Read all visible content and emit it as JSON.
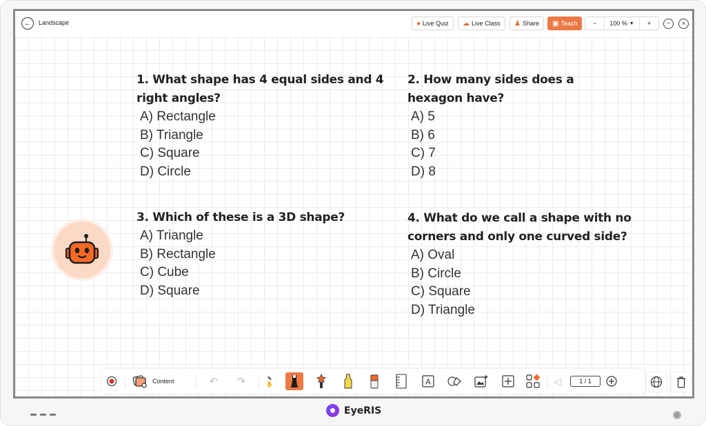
{
  "window": {
    "title": "Landscape"
  },
  "topbar": {
    "live_quiz": "Live Quiz",
    "live_class": "Live Class",
    "share": "Share",
    "teach": "Teach",
    "zoom_minus": "−",
    "zoom_value": "100 %",
    "zoom_plus": "+"
  },
  "questions": [
    {
      "title": "1. What shape has 4 equal sides and 4 right angles?",
      "options": [
        "A) Rectangle",
        "B) Triangle",
        "C) Square",
        "D) Circle"
      ]
    },
    {
      "title": "2. How many sides does a hexagon have?",
      "options": [
        "A) 5",
        "B) 6",
        "C) 7",
        "D) 8"
      ]
    },
    {
      "title": "3. Which of these is a 3D shape?",
      "options": [
        "A) Triangle",
        "B) Rectangle",
        "C) Cube",
        "D) Square"
      ]
    },
    {
      "title": "4. What do we call a shape with no corners and only one curved side?",
      "options": [
        "A) Oval",
        "B) Circle",
        "C) Square",
        "D) Triangle"
      ]
    }
  ],
  "toolbar": {
    "content_label": "Content",
    "page_indicator": "1 / 1"
  },
  "brand": {
    "name": "EyeRIS"
  },
  "colors": {
    "accent": "#ec7a45",
    "brand": "#7a3fe6"
  }
}
